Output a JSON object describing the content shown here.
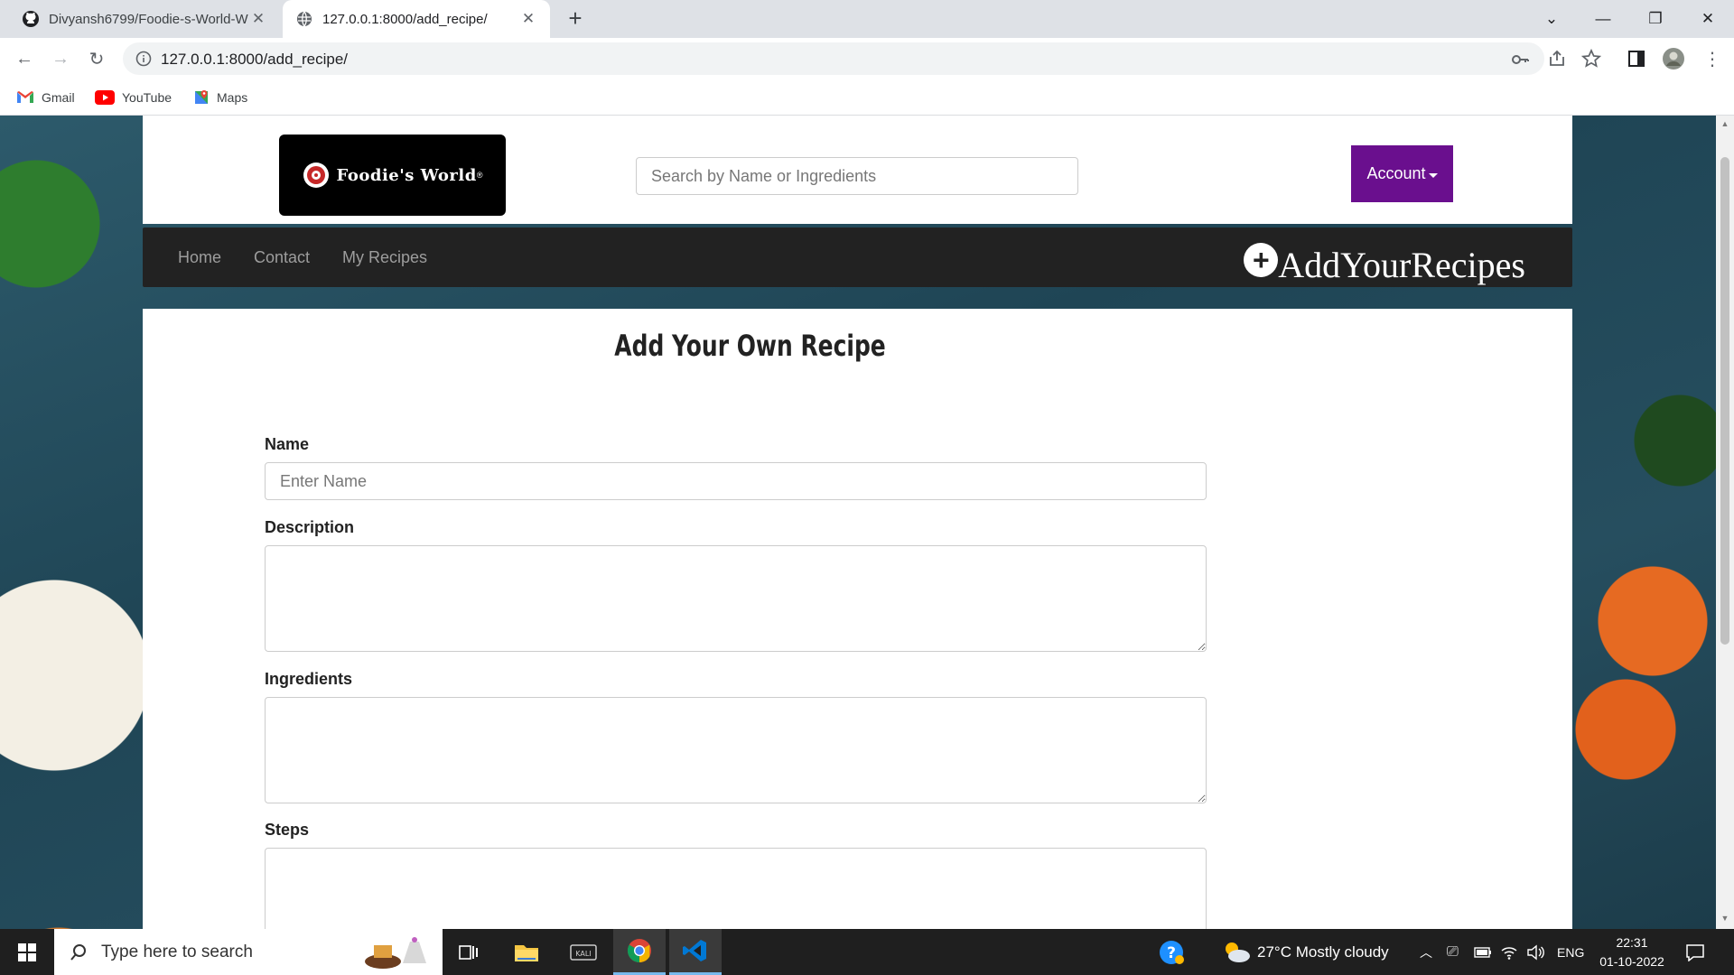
{
  "browser": {
    "tabs": [
      {
        "title": "Divyansh6799/Foodie-s-World-W",
        "active": false
      },
      {
        "title": "127.0.0.1:8000/add_recipe/",
        "active": true
      }
    ],
    "url": "127.0.0.1:8000/add_recipe/",
    "bookmarks": [
      "Gmail",
      "YouTube",
      "Maps"
    ]
  },
  "site": {
    "logo_text": "Foodie's World",
    "logo_mark": "®",
    "search_placeholder": "Search by Name or Ingredients",
    "account_label": "Account",
    "nav": [
      "Home",
      "Contact",
      "My Recipes"
    ],
    "add_recipes_label": "AddYourRecipes"
  },
  "form": {
    "title": "Add Your Own Recipe",
    "name_label": "Name",
    "name_placeholder": "Enter Name",
    "description_label": "Description",
    "ingredients_label": "Ingredients",
    "steps_label": "Steps"
  },
  "taskbar": {
    "search_placeholder": "Type here to search",
    "weather": "27°C  Mostly cloudy",
    "language": "ENG",
    "time": "22:31",
    "date": "01-10-2022"
  },
  "colors": {
    "account_bg": "#6a0f8e",
    "navbar_bg": "#222222",
    "chrome_frame": "#dee1e6"
  }
}
